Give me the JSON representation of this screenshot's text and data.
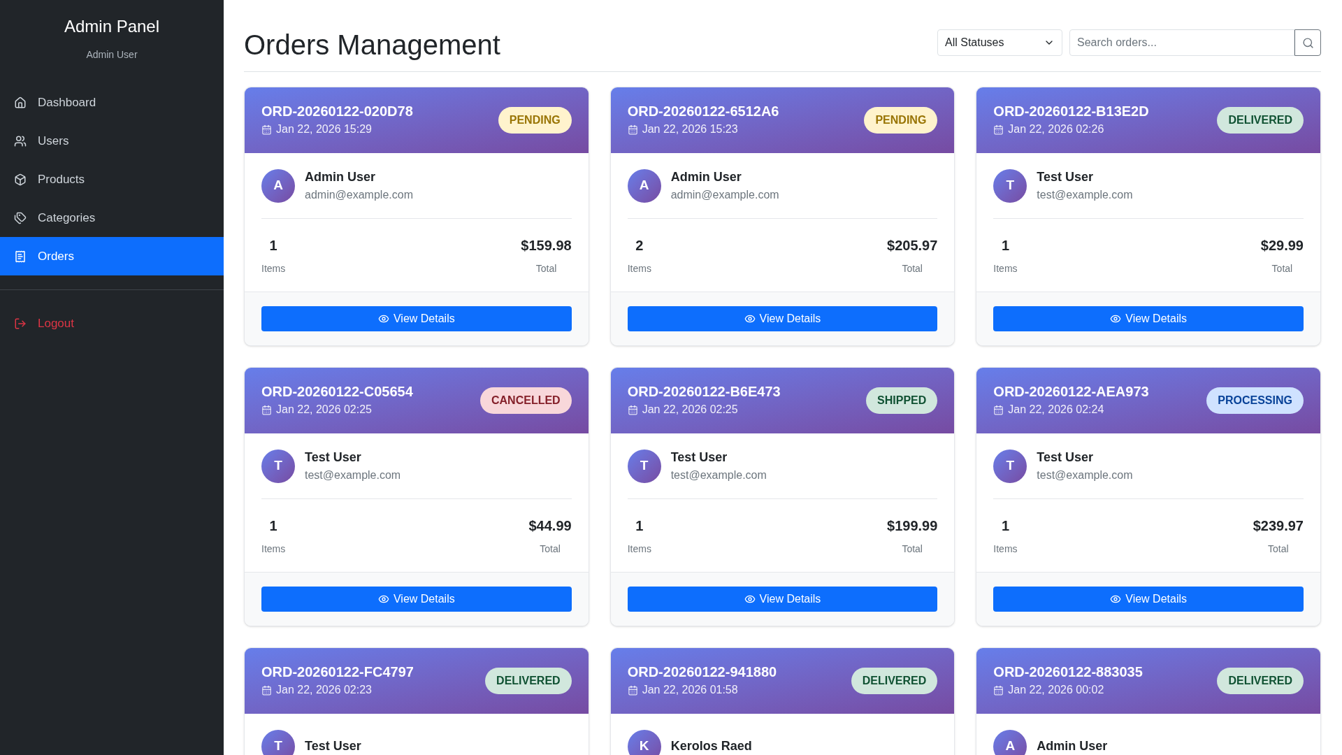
{
  "sidebar": {
    "title": "Admin Panel",
    "subtitle": "Admin User",
    "items": [
      {
        "label": "Dashboard",
        "kind": "home",
        "selected": false
      },
      {
        "label": "Users",
        "kind": "users",
        "selected": false
      },
      {
        "label": "Products",
        "kind": "products",
        "selected": false
      },
      {
        "label": "Categories",
        "kind": "categories",
        "selected": false
      },
      {
        "label": "Orders",
        "kind": "orders",
        "selected": true
      }
    ],
    "logout": {
      "label": "Logout"
    }
  },
  "header": {
    "title": "Orders Management",
    "filter": {
      "value": "All Statuses"
    },
    "search": {
      "placeholder": "Search orders..."
    }
  },
  "orders": [
    {
      "id": "ORD-20260122-020D78",
      "date": "Jan 22, 2026 15:29",
      "status": {
        "label": "PENDING",
        "kind": "pending"
      },
      "initial": "A",
      "name": "Admin User",
      "email": "admin@example.com",
      "items": "1",
      "items_label": "Items",
      "total": "$159.98",
      "total_label": "Total",
      "button": "View Details"
    },
    {
      "id": "ORD-20260122-6512A6",
      "date": "Jan 22, 2026 15:23",
      "status": {
        "label": "PENDING",
        "kind": "pending"
      },
      "initial": "A",
      "name": "Admin User",
      "email": "admin@example.com",
      "items": "2",
      "items_label": "Items",
      "total": "$205.97",
      "total_label": "Total",
      "button": "View Details"
    },
    {
      "id": "ORD-20260122-B13E2D",
      "date": "Jan 22, 2026 02:26",
      "status": {
        "label": "DELIVERED",
        "kind": "delivered"
      },
      "initial": "T",
      "name": "Test User",
      "email": "test@example.com",
      "items": "1",
      "items_label": "Items",
      "total": "$29.99",
      "total_label": "Total",
      "button": "View Details"
    },
    {
      "id": "ORD-20260122-C05654",
      "date": "Jan 22, 2026 02:25",
      "status": {
        "label": "CANCELLED",
        "kind": "cancelled"
      },
      "initial": "T",
      "name": "Test User",
      "email": "test@example.com",
      "items": "1",
      "items_label": "Items",
      "total": "$44.99",
      "total_label": "Total",
      "button": "View Details"
    },
    {
      "id": "ORD-20260122-B6E473",
      "date": "Jan 22, 2026 02:25",
      "status": {
        "label": "SHIPPED",
        "kind": "shipped"
      },
      "initial": "T",
      "name": "Test User",
      "email": "test@example.com",
      "items": "1",
      "items_label": "Items",
      "total": "$199.99",
      "total_label": "Total",
      "button": "View Details"
    },
    {
      "id": "ORD-20260122-AEA973",
      "date": "Jan 22, 2026 02:24",
      "status": {
        "label": "PROCESSING",
        "kind": "processing"
      },
      "initial": "T",
      "name": "Test User",
      "email": "test@example.com",
      "items": "1",
      "items_label": "Items",
      "total": "$239.97",
      "total_label": "Total",
      "button": "View Details"
    },
    {
      "id": "ORD-20260122-FC4797",
      "date": "Jan 22, 2026 02:23",
      "status": {
        "label": "DELIVERED",
        "kind": "delivered"
      },
      "initial": "T",
      "name": "Test User"
    },
    {
      "id": "ORD-20260122-941880",
      "date": "Jan 22, 2026 01:58",
      "status": {
        "label": "DELIVERED",
        "kind": "delivered"
      },
      "initial": "K",
      "name": "Kerolos Raed"
    },
    {
      "id": "ORD-20260122-883035",
      "date": "Jan 22, 2026 00:02",
      "status": {
        "label": "DELIVERED",
        "kind": "delivered"
      },
      "initial": "A",
      "name": "Admin User"
    }
  ]
}
